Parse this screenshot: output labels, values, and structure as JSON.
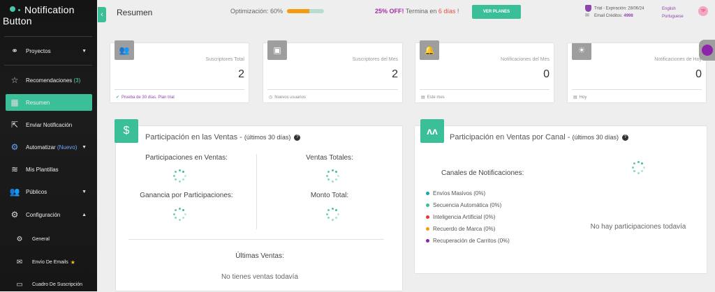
{
  "app": {
    "brand_line1": "Notification",
    "brand_line2": "Button"
  },
  "sidebar": {
    "items": [
      {
        "label": "Proyectos",
        "icon": "share-nodes-icon"
      },
      {
        "label": "Recomendaciones",
        "count": "(3)",
        "icon": "star-outline-icon"
      },
      {
        "label": "Resumen",
        "icon": "table-grid-icon",
        "active": true
      },
      {
        "label": "Enviar Notificación",
        "icon": "share-out-icon"
      },
      {
        "label": "Automatizar",
        "badge": "(Nuevo)",
        "icon": "gears-icon"
      },
      {
        "label": "Mis Plantillas",
        "icon": "layers-icon"
      },
      {
        "label": "Públicos",
        "icon": "users-icon"
      },
      {
        "label": "Configuración",
        "icon": "gear-icon"
      }
    ],
    "subitems": [
      {
        "label": "General",
        "icon": "gear-small-icon"
      },
      {
        "label": "Envío De Emails",
        "icon": "envelope-icon"
      },
      {
        "label": "Cuadro De Suscripción",
        "icon": "comment-icon"
      }
    ]
  },
  "header": {
    "title": "Resumen",
    "optimization_label": "Optimización: 60%",
    "optimization_value": 0.6,
    "promo_off": "25% OFF!",
    "promo_text": " Termina en ",
    "promo_days": "6 días",
    "promo_end": " !",
    "plan_button": "VER PLANES",
    "trial": "Trial - Expiración: 28/06/24",
    "email_credits_label": "Email Créditos: ",
    "email_credits": "4998",
    "lang1": "English",
    "lang2": "Portuguese",
    "avatar": "TP"
  },
  "stats": [
    {
      "label": "Suscriptores Total",
      "value": "2",
      "footer": "Prueba de 30 días. Plan trial",
      "icon": "users-icon"
    },
    {
      "label": "Suscriptores del Mes",
      "value": "2",
      "footer": "Nuevos usuarios",
      "icon": "contact-icon"
    },
    {
      "label": "Notificaciones del Mes",
      "value": "0",
      "footer": "Este mes",
      "icon": "bell-icon"
    },
    {
      "label": "Notificaciones de Hoy",
      "value": "0",
      "footer": "Hoy",
      "icon": "sun-icon"
    }
  ],
  "sales": {
    "title": "Participación en las Ventas - ",
    "period": "(últimos 30 días)",
    "m1": "Participaciones en Ventas:",
    "m2": "Ventas Totales:",
    "m3": "Ganancia por Participaciones:",
    "m4": "Monto Total:",
    "last_title": "Últimas Ventas:",
    "last_empty": "No tienes ventas todavía"
  },
  "channel": {
    "title": "Participación en Ventas por Canal - ",
    "period": "(últimos 30 días)",
    "legend_title": "Canales de Notificaciones:",
    "legend": [
      {
        "label": "Envíos Masivos (0%)",
        "color": "#17a2b8"
      },
      {
        "label": "Secuencia Automática (0%)",
        "color": "#3bbf98"
      },
      {
        "label": "Inteligencia Artificial (0%)",
        "color": "#e53935"
      },
      {
        "label": "Recuerdo de Marca (0%)",
        "color": "#f39c12"
      },
      {
        "label": "Recuperación de Carritos (0%)",
        "color": "#8e24aa"
      }
    ],
    "empty": "No hay participaciones todavía"
  }
}
